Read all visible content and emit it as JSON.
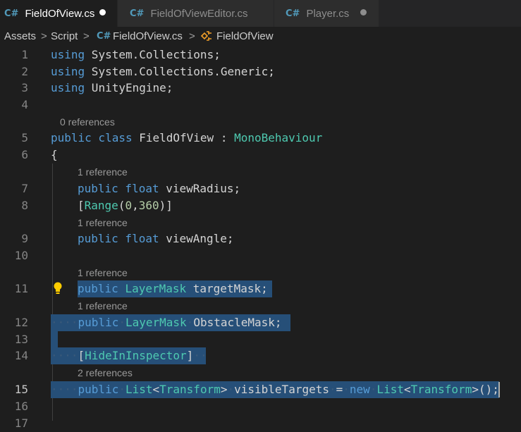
{
  "tabs": [
    {
      "label": "FieldOfView.cs",
      "icon": "C#",
      "active": true,
      "modified": true
    },
    {
      "label": "FieldOfViewEditor.cs",
      "icon": "C#",
      "active": false,
      "modified": false
    },
    {
      "label": "Player.cs",
      "icon": "C#",
      "active": false,
      "modified": true
    }
  ],
  "breadcrumb": {
    "segments": [
      "Assets",
      "Script",
      "FieldOfView.cs",
      "FieldOfView"
    ],
    "separator": ">",
    "file_icon": "C#"
  },
  "line_numbers": [
    "1",
    "2",
    "3",
    "4",
    "5",
    "6",
    "7",
    "8",
    "9",
    "10",
    "11",
    "12",
    "13",
    "14",
    "15",
    "16",
    "17"
  ],
  "code_lens": [
    "0 references",
    "1 reference",
    "1 reference",
    "1 reference",
    "1 reference",
    "2 references"
  ],
  "code": {
    "l1": [
      "using",
      " System.Collections;"
    ],
    "l2": [
      "using",
      " System.Collections.Generic;"
    ],
    "l3": [
      "using",
      " UnityEngine;"
    ],
    "l5": [
      "public class",
      " FieldOfView : ",
      "MonoBehaviour"
    ],
    "l6": "{",
    "l7": [
      "public float",
      " viewRadius;"
    ],
    "l8": [
      "[",
      "Range",
      "(",
      "0",
      ",",
      "360",
      ")]"
    ],
    "l9": [
      "public float",
      " viewAngle;"
    ],
    "l11": [
      "public",
      " ",
      "LayerMask",
      " targetMask;"
    ],
    "l12": [
      "public",
      "LayerMask",
      "ObstacleMask;"
    ],
    "l14": [
      "[",
      "HideInInspector",
      "]"
    ],
    "l15": [
      "public",
      "List",
      "<",
      "Transform",
      ">",
      "visibleTargets",
      "=",
      "new",
      "List",
      "<",
      "Transform",
      ">();"
    ]
  },
  "icons": {
    "lightbulb": "lightbulb-icon",
    "cs_file": "csharp-file-icon",
    "class_symbol": "class-symbol-icon"
  },
  "colors": {
    "keyword": "#569cd6",
    "type": "#4ec9b0",
    "number": "#b5cea8",
    "selection": "#264f78",
    "lightbulb": "#ffcc00"
  }
}
